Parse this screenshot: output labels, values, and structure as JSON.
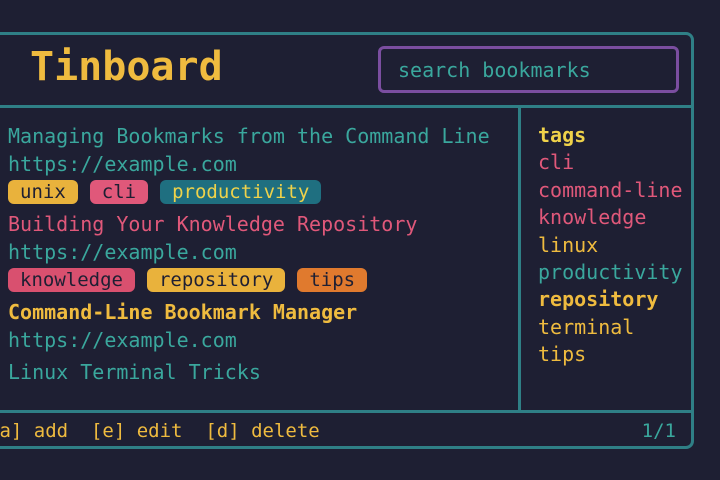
{
  "app": {
    "title": "Tinboard"
  },
  "search": {
    "placeholder": "search bookmarks"
  },
  "bookmarks": [
    {
      "title": "Managing Bookmarks from the Command Line",
      "color": "#3aa79d",
      "url": "https://example.com",
      "tags": [
        {
          "label": "unix",
          "bg": "#e9b23c",
          "fg": "#1e1f33"
        },
        {
          "label": "cli",
          "bg": "#e0587a",
          "fg": "#1e1f33"
        },
        {
          "label": "productivity",
          "bg": "#1f6f80",
          "fg": "#efd24a"
        }
      ]
    },
    {
      "title": "Building Your Knowledge Repository",
      "color": "#e0587a",
      "url": "https://example.com",
      "tags": [
        {
          "label": "knowledge",
          "bg": "#d9506f",
          "fg": "#1e1f33"
        },
        {
          "label": "repository",
          "bg": "#e9b23c",
          "fg": "#1e1f33"
        },
        {
          "label": "tips",
          "bg": "#e07a2e",
          "fg": "#1e1f33"
        }
      ]
    },
    {
      "title": "Command-Line Bookmark Manager",
      "color": "#efbb3f",
      "url": "https://example.com",
      "tags": []
    },
    {
      "title": "Linux Terminal Tricks",
      "color": "#3aa79d",
      "url": null,
      "tags": []
    }
  ],
  "sidebar": {
    "heading": "tags",
    "items": [
      {
        "label": "cli",
        "color": "#e0587a"
      },
      {
        "label": "command-line",
        "color": "#e0587a"
      },
      {
        "label": "knowledge",
        "color": "#e0587a"
      },
      {
        "label": "linux",
        "color": "#efbb3f"
      },
      {
        "label": "productivity",
        "color": "#3aa79d"
      },
      {
        "label": "repository",
        "color": "#efbb3f",
        "bold": true
      },
      {
        "label": "terminal",
        "color": "#efbb3f"
      },
      {
        "label": "tips",
        "color": "#efbb3f"
      }
    ]
  },
  "footer": {
    "keys": "[a] add  [e] edit  [d] delete",
    "page": "1/1"
  }
}
